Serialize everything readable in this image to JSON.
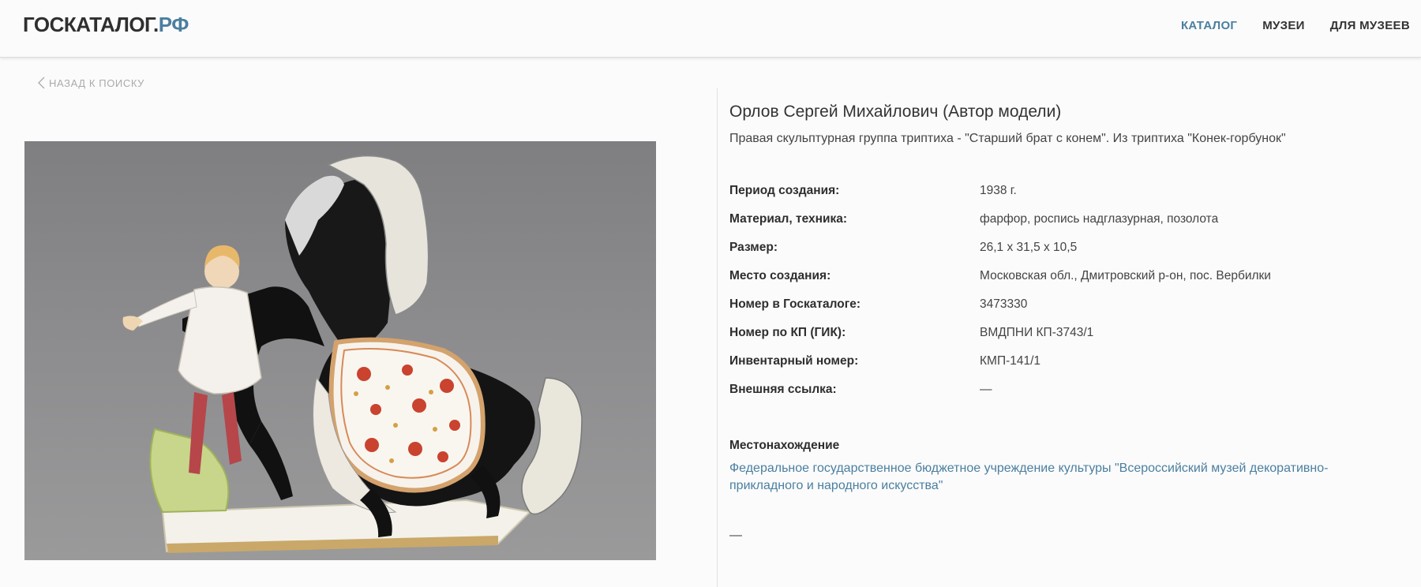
{
  "header": {
    "logo_main": "ГОСКАТАЛОГ.",
    "logo_suffix": "РФ",
    "nav": [
      {
        "label": "КАТАЛОГ",
        "active": true
      },
      {
        "label": "МУЗЕИ",
        "active": false
      },
      {
        "label": "ДЛЯ МУЗЕЕВ",
        "active": false
      }
    ],
    "accent_color": "#4a7fa0"
  },
  "back_link": {
    "label": "НАЗАД К ПОИСКУ",
    "icon": "chevron-left-icon"
  },
  "item": {
    "title": "Орлов Сергей Михайлович (Автор модели)",
    "subtitle": "Правая скульптурная группа триптиха - \"Старший брат с конем\". Из триптиха \"Конек-горбунок\"",
    "properties": [
      {
        "key": "Период создания:",
        "value": "1938 г."
      },
      {
        "key": "Материал, техника:",
        "value": "фарфор, роспись надглазурная, позолота"
      },
      {
        "key": "Размер:",
        "value": "26,1 x 31,5 x 10,5"
      },
      {
        "key": "Место создания:",
        "value": "Московская обл., Дмитровский р-он, пос. Вербилки"
      },
      {
        "key": "Номер в Госкаталоге:",
        "value": "3473330"
      },
      {
        "key": "Номер по КП (ГИК):",
        "value": "ВМДПНИ КП-3743/1"
      },
      {
        "key": "Инвентарный номер:",
        "value": "КМП-141/1"
      },
      {
        "key": "Внешняя ссылка:",
        "value": "—"
      }
    ],
    "location_heading": "Местонахождение",
    "location_link": "Федеральное государственное бюджетное учреждение культуры \"Всероссийский музей декоративно-прикладного и народного искусства\"",
    "bottom_dash": "—"
  }
}
